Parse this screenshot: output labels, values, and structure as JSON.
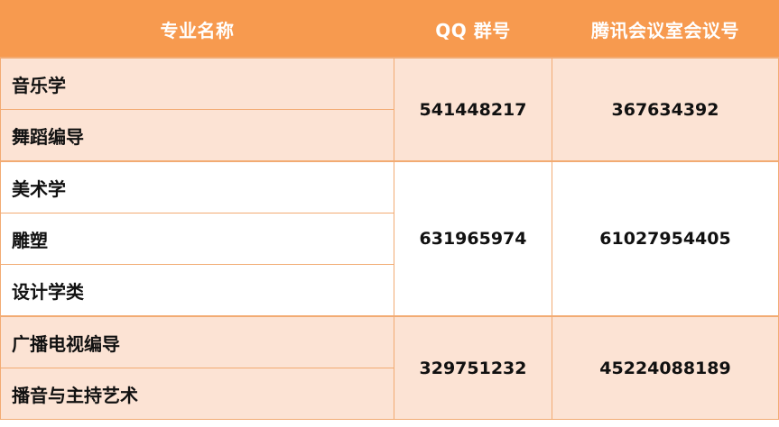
{
  "header": {
    "major_name": "专业名称",
    "qq_group": "QQ 群号",
    "tencent_meeting": "腾讯会议室会议号"
  },
  "groups": [
    {
      "majors": [
        "音乐学",
        "舞蹈编导"
      ],
      "qq": "541448217",
      "meeting": "367634392"
    },
    {
      "majors": [
        "美术学",
        "雕塑",
        "设计学类"
      ],
      "qq": "631965974",
      "meeting": "61027954405"
    },
    {
      "majors": [
        "广播电视编导",
        "播音与主持艺术"
      ],
      "qq": "329751232",
      "meeting": "45224088189"
    }
  ],
  "colors": {
    "header_bg": "#f79a4f",
    "header_text": "#ffffff",
    "shaded_row_bg": "#fce3d4",
    "plain_row_bg": "#ffffff",
    "border": "#f2ab73"
  }
}
